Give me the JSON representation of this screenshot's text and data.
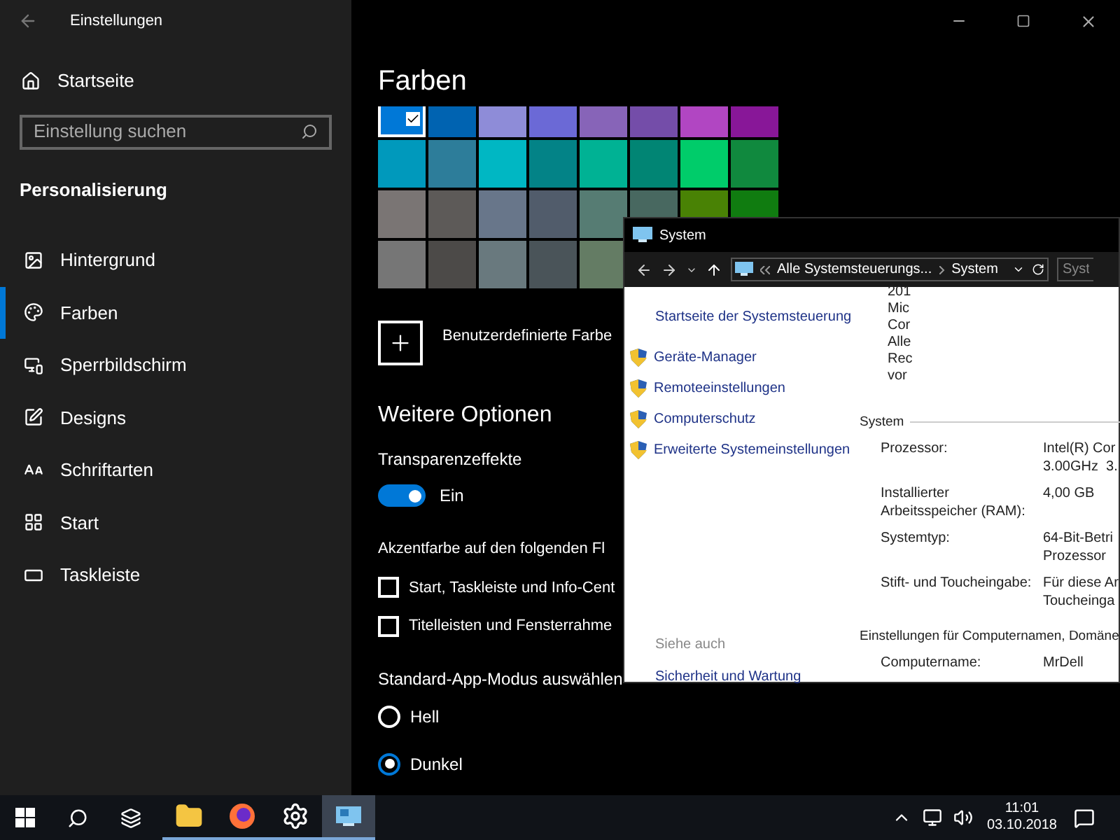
{
  "settings_window": {
    "title": "Einstellungen",
    "sidebar": {
      "home": "Startseite",
      "search": {
        "placeholder": "Einstellung suchen"
      },
      "section": "Personalisierung",
      "items": [
        {
          "label": "Hintergrund",
          "selected": false
        },
        {
          "label": "Farben",
          "selected": true
        },
        {
          "label": "Sperrbildschirm",
          "selected": false
        },
        {
          "label": "Designs",
          "selected": false
        },
        {
          "label": "Schriftarten",
          "selected": false
        },
        {
          "label": "Start",
          "selected": false
        },
        {
          "label": "Taskleiste",
          "selected": false
        }
      ]
    },
    "page": {
      "title": "Farben",
      "swatches": [
        {
          "color": "#0078d7",
          "selected": true
        },
        {
          "color": "#0063b1",
          "selected": false
        },
        {
          "color": "#8e8cd8",
          "selected": false
        },
        {
          "color": "#6b69d6",
          "selected": false
        },
        {
          "color": "#8764b8",
          "selected": false
        },
        {
          "color": "#744da9",
          "selected": false
        },
        {
          "color": "#b146c2",
          "selected": false
        },
        {
          "color": "#881798",
          "selected": false
        },
        {
          "color": "#0099bc",
          "selected": false
        },
        {
          "color": "#2d7d9a",
          "selected": false
        },
        {
          "color": "#00b7c3",
          "selected": false
        },
        {
          "color": "#038387",
          "selected": false
        },
        {
          "color": "#00b294",
          "selected": false
        },
        {
          "color": "#018574",
          "selected": false
        },
        {
          "color": "#00cc6a",
          "selected": false
        },
        {
          "color": "#10893e",
          "selected": false
        },
        {
          "color": "#7a7574",
          "selected": false
        },
        {
          "color": "#5d5a58",
          "selected": false
        },
        {
          "color": "#68768a",
          "selected": false
        },
        {
          "color": "#515c6b",
          "selected": false
        },
        {
          "color": "#567c73",
          "selected": false
        },
        {
          "color": "#486860",
          "selected": false
        },
        {
          "color": "#498205",
          "selected": false
        },
        {
          "color": "#107c10",
          "selected": false
        },
        {
          "color": "#767676",
          "selected": false
        },
        {
          "color": "#4c4a48",
          "selected": false
        },
        {
          "color": "#69797e",
          "selected": false
        },
        {
          "color": "#4a5459",
          "selected": false
        },
        {
          "color": "#647c64",
          "selected": false
        }
      ],
      "custom_color": "Benutzerdefinierte Farbe",
      "more_options": "Weitere Optionen",
      "transparency": {
        "label": "Transparenzeffekte",
        "on": true,
        "state": "Ein"
      },
      "accent_heading": "Akzentfarbe auf den folgenden Fl",
      "accent_targets": [
        {
          "label": "Start, Taskleiste und Info-Cent",
          "checked": false
        },
        {
          "label": "Titelleisten und Fensterrahme",
          "checked": false
        }
      ],
      "app_mode": {
        "heading": "Standard-App-Modus auswählen",
        "options": [
          {
            "label": "Hell",
            "selected": false
          },
          {
            "label": "Dunkel",
            "selected": true
          }
        ]
      }
    }
  },
  "system_window": {
    "title": "System",
    "address": [
      "Alle Systemsteuerungs...",
      "System"
    ],
    "search": {
      "placeholder": "Syst"
    },
    "home_link": "Startseite der Systemsteuerung",
    "links": [
      "Geräte-Manager",
      "Remoteeinstellungen",
      "Computerschutz",
      "Erweiterte Systemeinstellungen"
    ],
    "see_also": {
      "heading": "Siehe auch",
      "links": [
        "Sicherheit und Wartung"
      ]
    },
    "top_lines": [
      "201",
      "Mic",
      "Cor",
      "Alle",
      "Rec",
      "vor"
    ],
    "sections": [
      {
        "title": "System",
        "rows": [
          {
            "label": "Prozessor:",
            "value": [
              "Intel(R) Cor",
              "3.00GHz  3."
            ]
          },
          {
            "label": "Installierter Arbeitsspeicher (RAM):",
            "value": [
              "4,00 GB"
            ]
          },
          {
            "label": "Systemtyp:",
            "value": [
              "64-Bit-Betri",
              "Prozessor"
            ]
          },
          {
            "label": "Stift- und Toucheingabe:",
            "value": [
              "Für diese Ar",
              "Toucheinga"
            ]
          }
        ]
      },
      {
        "title": "Einstellungen für Computernamen, Domäne",
        "rows": [
          {
            "label": "Computername:",
            "value": [
              "MrDell"
            ]
          }
        ]
      }
    ]
  },
  "taskbar": {
    "apps": [
      {
        "kind": "explorer",
        "running": true,
        "active": false
      },
      {
        "kind": "firefox",
        "running": true,
        "active": false
      },
      {
        "kind": "settings",
        "running": true,
        "active": false
      },
      {
        "kind": "system",
        "running": true,
        "active": true
      }
    ],
    "clock": {
      "time": "11:01",
      "date": "03.10.2018"
    }
  }
}
